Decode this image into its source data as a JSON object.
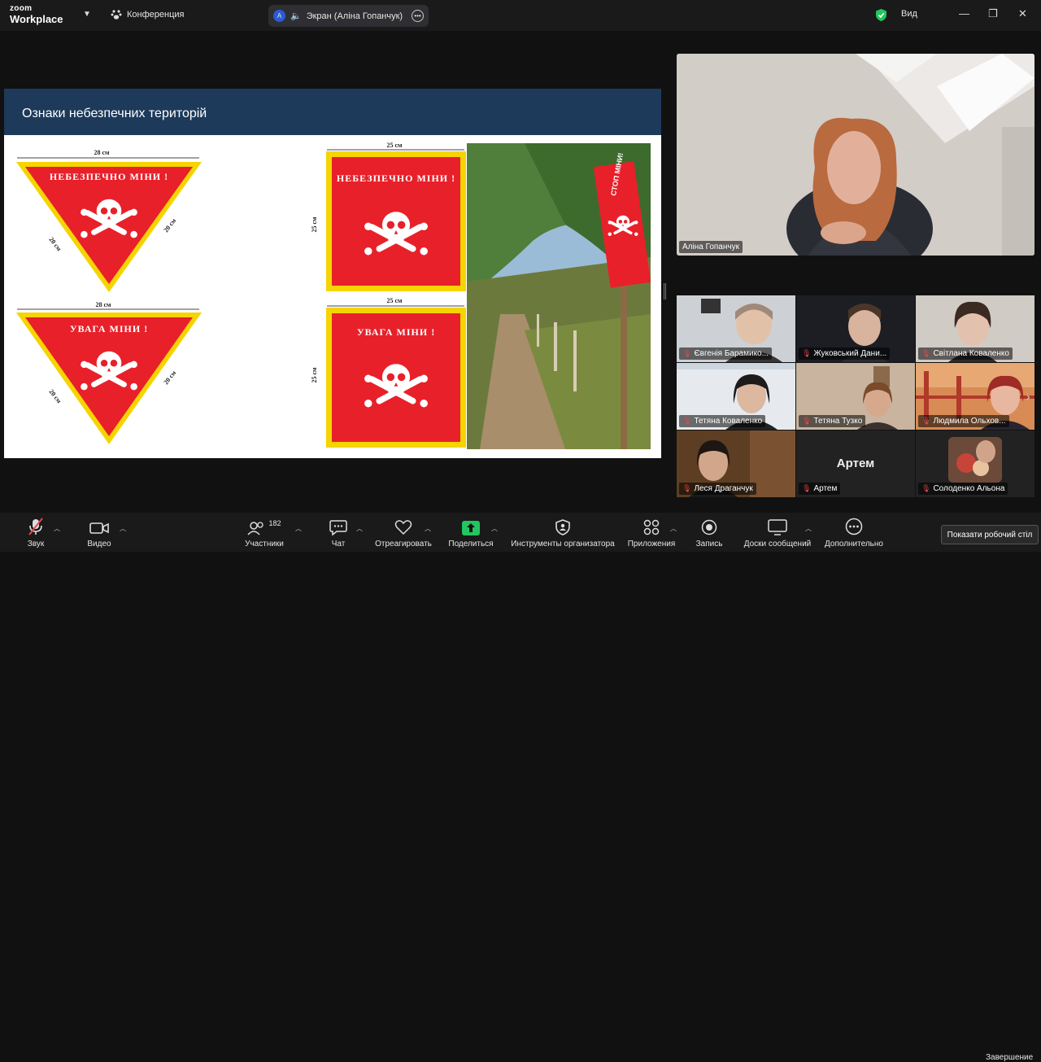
{
  "titlebar": {
    "brand_top": "zoom",
    "brand_bottom": "Workplace",
    "meeting_label": "Конференция",
    "share": {
      "avatar": "A",
      "label": "Экран (Аліна Гопанчук)"
    },
    "view_label": "Вид",
    "icons": {
      "shield": "shield-check-icon",
      "minimize": "minimize-icon",
      "restore": "restore-icon",
      "close": "close-icon"
    }
  },
  "slide": {
    "title": "Ознаки небезпечних територій",
    "signs": {
      "danger": "НЕБЕЗПЕЧНО МІНИ !",
      "warning": "УВАГА МІНИ !",
      "dim28": "28 см",
      "dim20": "20 см",
      "dim25": "25 см"
    },
    "photo_sign": "СТОП МІНИ!"
  },
  "speaker": {
    "name": "Аліна Гопанчук"
  },
  "participants": [
    {
      "name": "Євгенія Барамико..."
    },
    {
      "name": "Жуковський Дани..."
    },
    {
      "name": "Світлана Коваленко"
    },
    {
      "name": "Тетяна  Коваленко"
    },
    {
      "name": "Тетяна Тузко"
    },
    {
      "name": "Людмила Ольхов..."
    },
    {
      "name": "Леся Драганчук"
    },
    {
      "name": "Артем",
      "big": "Артем"
    },
    {
      "name": "Солоденко Альона"
    }
  ],
  "toolbar": {
    "audio": "Звук",
    "video": "Видео",
    "participants": "Участники",
    "participants_count": "182",
    "chat": "Чат",
    "react": "Отреагировать",
    "share": "Поделиться",
    "host_tools": "Инструменты организатора",
    "apps": "Приложения",
    "record": "Запись",
    "whiteboards": "Доски сообщений",
    "more": "Дополнительно",
    "end": "Завершение",
    "tooltip": "Показати робочий стіл"
  },
  "colors": {
    "accent_green": "#22c55e",
    "sign_red": "#e8202a",
    "sign_yellow": "#f5d400",
    "header_blue": "#1d3a5a"
  }
}
